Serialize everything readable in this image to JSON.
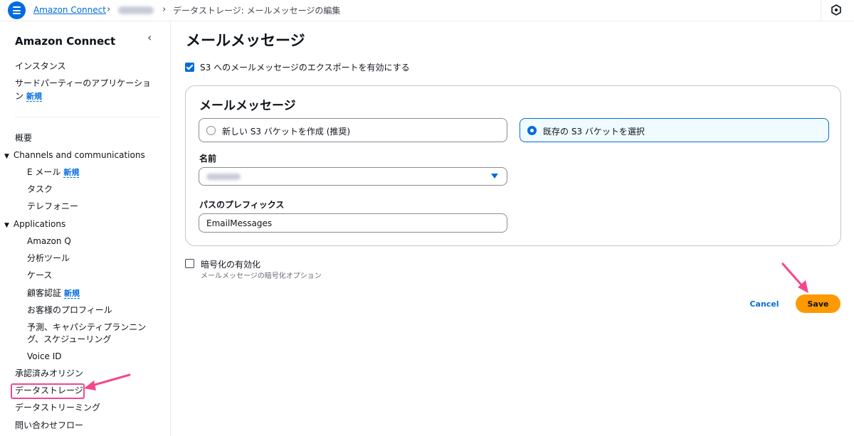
{
  "header": {
    "breadcrumbs": [
      "Amazon Connect",
      "データストレージ: メールメッセージの編集"
    ]
  },
  "sidebar": {
    "title": "Amazon Connect",
    "new_badge": "新規",
    "top_items": [
      "インスタンス",
      "サードパーティーのアプリケーショ",
      "ン"
    ],
    "overview": "概要",
    "channels_section": "Channels and communications",
    "channels_items": [
      "E メール",
      "タスク",
      "テレフォニー"
    ],
    "applications_section": "Applications",
    "applications_items": [
      "Amazon Q",
      "分析ツール",
      "ケース",
      "顧客認証",
      "お客様のプロフィール",
      "予測、キャパシティプランニン",
      "グ、スケジューリング",
      "Voice ID"
    ],
    "bottom_items": [
      "承認済みオリジン",
      "データストレージ",
      "データストリーミング",
      "問い合わせフロー"
    ]
  },
  "main": {
    "title": "メールメッセージ",
    "export_checkbox_label": "S3 へのメールメッセージのエクスポートを有効にする",
    "card": {
      "title": "メールメッセージ",
      "option_new": "新しい S3 バケットを作成 (推奨)",
      "option_existing": "既存の S3 バケットを選択",
      "name_label": "名前",
      "prefix_label": "パスのプレフィックス",
      "prefix_value": "EmailMessages"
    },
    "encryption_label": "暗号化の有効化",
    "encryption_sublabel": "メールメッセージの暗号化オプション",
    "cancel_label": "Cancel",
    "save_label": "Save"
  },
  "colors": {
    "accent": "#006ce0",
    "save_button": "#ff9900",
    "annotation": "#f5468c"
  }
}
